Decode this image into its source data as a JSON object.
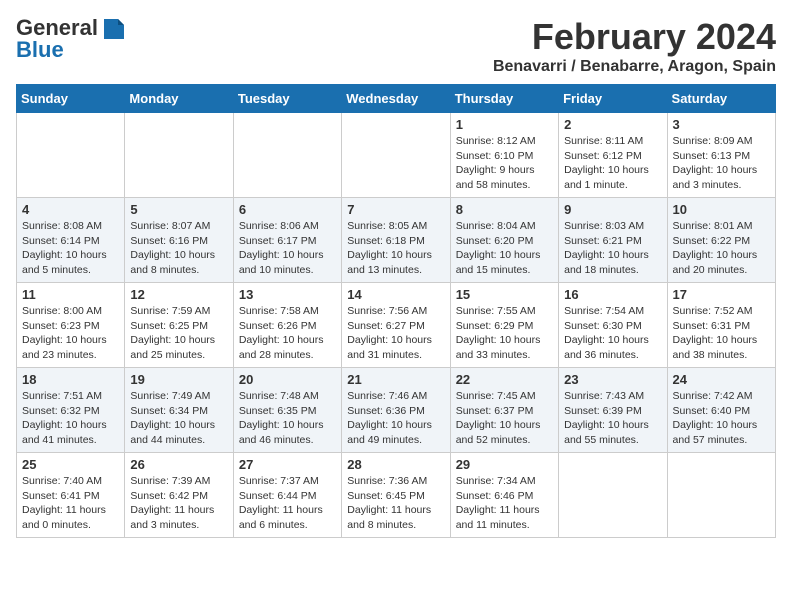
{
  "header": {
    "logo_line1": "General",
    "logo_line2": "Blue",
    "month_title": "February 2024",
    "location": "Benavarri / Benabarre, Aragon, Spain"
  },
  "days_of_week": [
    "Sunday",
    "Monday",
    "Tuesday",
    "Wednesday",
    "Thursday",
    "Friday",
    "Saturday"
  ],
  "weeks": [
    [
      {
        "num": "",
        "info": ""
      },
      {
        "num": "",
        "info": ""
      },
      {
        "num": "",
        "info": ""
      },
      {
        "num": "",
        "info": ""
      },
      {
        "num": "1",
        "info": "Sunrise: 8:12 AM\nSunset: 6:10 PM\nDaylight: 9 hours\nand 58 minutes."
      },
      {
        "num": "2",
        "info": "Sunrise: 8:11 AM\nSunset: 6:12 PM\nDaylight: 10 hours\nand 1 minute."
      },
      {
        "num": "3",
        "info": "Sunrise: 8:09 AM\nSunset: 6:13 PM\nDaylight: 10 hours\nand 3 minutes."
      }
    ],
    [
      {
        "num": "4",
        "info": "Sunrise: 8:08 AM\nSunset: 6:14 PM\nDaylight: 10 hours\nand 5 minutes."
      },
      {
        "num": "5",
        "info": "Sunrise: 8:07 AM\nSunset: 6:16 PM\nDaylight: 10 hours\nand 8 minutes."
      },
      {
        "num": "6",
        "info": "Sunrise: 8:06 AM\nSunset: 6:17 PM\nDaylight: 10 hours\nand 10 minutes."
      },
      {
        "num": "7",
        "info": "Sunrise: 8:05 AM\nSunset: 6:18 PM\nDaylight: 10 hours\nand 13 minutes."
      },
      {
        "num": "8",
        "info": "Sunrise: 8:04 AM\nSunset: 6:20 PM\nDaylight: 10 hours\nand 15 minutes."
      },
      {
        "num": "9",
        "info": "Sunrise: 8:03 AM\nSunset: 6:21 PM\nDaylight: 10 hours\nand 18 minutes."
      },
      {
        "num": "10",
        "info": "Sunrise: 8:01 AM\nSunset: 6:22 PM\nDaylight: 10 hours\nand 20 minutes."
      }
    ],
    [
      {
        "num": "11",
        "info": "Sunrise: 8:00 AM\nSunset: 6:23 PM\nDaylight: 10 hours\nand 23 minutes."
      },
      {
        "num": "12",
        "info": "Sunrise: 7:59 AM\nSunset: 6:25 PM\nDaylight: 10 hours\nand 25 minutes."
      },
      {
        "num": "13",
        "info": "Sunrise: 7:58 AM\nSunset: 6:26 PM\nDaylight: 10 hours\nand 28 minutes."
      },
      {
        "num": "14",
        "info": "Sunrise: 7:56 AM\nSunset: 6:27 PM\nDaylight: 10 hours\nand 31 minutes."
      },
      {
        "num": "15",
        "info": "Sunrise: 7:55 AM\nSunset: 6:29 PM\nDaylight: 10 hours\nand 33 minutes."
      },
      {
        "num": "16",
        "info": "Sunrise: 7:54 AM\nSunset: 6:30 PM\nDaylight: 10 hours\nand 36 minutes."
      },
      {
        "num": "17",
        "info": "Sunrise: 7:52 AM\nSunset: 6:31 PM\nDaylight: 10 hours\nand 38 minutes."
      }
    ],
    [
      {
        "num": "18",
        "info": "Sunrise: 7:51 AM\nSunset: 6:32 PM\nDaylight: 10 hours\nand 41 minutes."
      },
      {
        "num": "19",
        "info": "Sunrise: 7:49 AM\nSunset: 6:34 PM\nDaylight: 10 hours\nand 44 minutes."
      },
      {
        "num": "20",
        "info": "Sunrise: 7:48 AM\nSunset: 6:35 PM\nDaylight: 10 hours\nand 46 minutes."
      },
      {
        "num": "21",
        "info": "Sunrise: 7:46 AM\nSunset: 6:36 PM\nDaylight: 10 hours\nand 49 minutes."
      },
      {
        "num": "22",
        "info": "Sunrise: 7:45 AM\nSunset: 6:37 PM\nDaylight: 10 hours\nand 52 minutes."
      },
      {
        "num": "23",
        "info": "Sunrise: 7:43 AM\nSunset: 6:39 PM\nDaylight: 10 hours\nand 55 minutes."
      },
      {
        "num": "24",
        "info": "Sunrise: 7:42 AM\nSunset: 6:40 PM\nDaylight: 10 hours\nand 57 minutes."
      }
    ],
    [
      {
        "num": "25",
        "info": "Sunrise: 7:40 AM\nSunset: 6:41 PM\nDaylight: 11 hours\nand 0 minutes."
      },
      {
        "num": "26",
        "info": "Sunrise: 7:39 AM\nSunset: 6:42 PM\nDaylight: 11 hours\nand 3 minutes."
      },
      {
        "num": "27",
        "info": "Sunrise: 7:37 AM\nSunset: 6:44 PM\nDaylight: 11 hours\nand 6 minutes."
      },
      {
        "num": "28",
        "info": "Sunrise: 7:36 AM\nSunset: 6:45 PM\nDaylight: 11 hours\nand 8 minutes."
      },
      {
        "num": "29",
        "info": "Sunrise: 7:34 AM\nSunset: 6:46 PM\nDaylight: 11 hours\nand 11 minutes."
      },
      {
        "num": "",
        "info": ""
      },
      {
        "num": "",
        "info": ""
      }
    ]
  ]
}
